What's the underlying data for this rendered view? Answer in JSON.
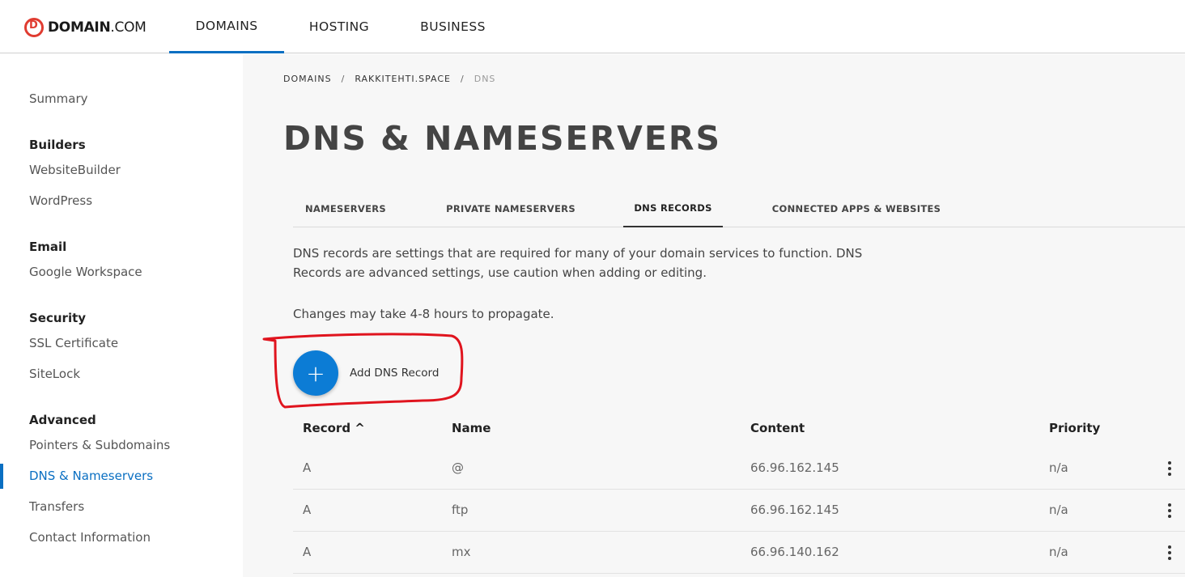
{
  "header": {
    "logo_brand": "DOMAIN",
    "logo_suffix": ".COM",
    "nav": [
      {
        "label": "DOMAINS",
        "active": true
      },
      {
        "label": "HOSTING",
        "active": false
      },
      {
        "label": "BUSINESS",
        "active": false
      }
    ]
  },
  "sidebar": {
    "summary": "Summary",
    "sections": [
      {
        "heading": "Builders",
        "items": [
          "WebsiteBuilder",
          "WordPress"
        ]
      },
      {
        "heading": "Email",
        "items": [
          "Google Workspace"
        ]
      },
      {
        "heading": "Security",
        "items": [
          "SSL Certificate",
          "SiteLock"
        ]
      },
      {
        "heading": "Advanced",
        "items": [
          "Pointers & Subdomains",
          "DNS & Nameservers",
          "Transfers",
          "Contact Information"
        ]
      }
    ],
    "active_item": "DNS & Nameservers"
  },
  "breadcrumb": [
    "DOMAINS",
    "RAKKITEHTI.SPACE",
    "DNS"
  ],
  "breadcrumb_sep": "/",
  "page_title": "DNS & NAMESERVERS",
  "tabs": [
    {
      "label": "NAMESERVERS",
      "active": false
    },
    {
      "label": "PRIVATE NAMESERVERS",
      "active": false
    },
    {
      "label": "DNS RECORDS",
      "active": true
    },
    {
      "label": "CONNECTED APPS & WEBSITES",
      "active": false
    }
  ],
  "description": "DNS records are settings that are required for many of your domain services to function. DNS Records are advanced settings, use caution when adding or editing.",
  "propagation_note": "Changes may take 4-8 hours to propagate.",
  "add_button": {
    "icon": "+",
    "label": "Add DNS Record"
  },
  "table": {
    "columns": [
      "Record",
      "Name",
      "Content",
      "Priority"
    ],
    "sort_indicator": "^",
    "rows": [
      {
        "record": "A",
        "name": "@",
        "content": "66.96.162.145",
        "priority": "n/a"
      },
      {
        "record": "A",
        "name": "ftp",
        "content": "66.96.162.145",
        "priority": "n/a"
      },
      {
        "record": "A",
        "name": "mx",
        "content": "66.96.140.162",
        "priority": "n/a"
      }
    ]
  },
  "colors": {
    "accent": "#0a6fc2",
    "add_button": "#0c7cd5",
    "logo": "#e03c31",
    "annotation": "#e0141e"
  }
}
